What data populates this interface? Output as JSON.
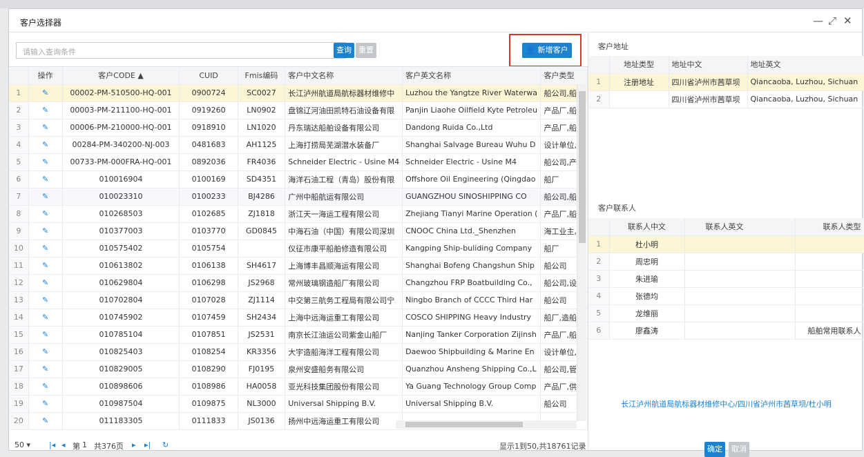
{
  "window": {
    "title": "客户选择器",
    "minimize": "—",
    "maximize": "⤢",
    "close": "✕"
  },
  "search": {
    "placeholder": "请输入查询条件",
    "query_label": "查询",
    "reset_label": "重置",
    "add_label": "新增客户"
  },
  "grid": {
    "headers": {
      "op": "操作",
      "code": "客户CODE ▲",
      "cuid": "CUID",
      "fmis": "Fmis编码",
      "cn": "客户中文名称",
      "en": "客户英文名称",
      "type": "客户类型"
    },
    "rows": [
      {
        "n": "1",
        "code": "00002-PM-510500-HQ-001",
        "cuid": "0900724",
        "fmis": "SC0027",
        "cn": "长江泸州航道局航标器材维修中",
        "en": "Luzhou the Yangtze River Waterwa",
        "type": "船公司,船厂"
      },
      {
        "n": "2",
        "code": "00003-PM-211100-HQ-001",
        "cuid": "0919260",
        "fmis": "LN0902",
        "cn": "盘锦辽河油田凯特石油设备有限",
        "en": "Panjin Liaohe Oilfield Kyte Petroleu",
        "type": "产品厂,船公"
      },
      {
        "n": "3",
        "code": "00006-PM-210000-HQ-001",
        "cuid": "0918910",
        "fmis": "LN1020",
        "cn": "丹东瑞达船舶设备有限公司",
        "en": "Dandong Ruida Co.,Ltd",
        "type": "产品厂,船厂"
      },
      {
        "n": "4",
        "code": "00284-PM-340200-NJ-003",
        "cuid": "0481683",
        "fmis": "AH1125",
        "cn": "上海打捞局芜湖潜水装备厂",
        "en": "Shanghai Salvage Bureau Wuhu D",
        "type": "设计单位,产"
      },
      {
        "n": "5",
        "code": "00733-PM-000FRA-HQ-001",
        "cuid": "0892036",
        "fmis": "FR4036",
        "cn": "Schneider Electric - Usine M4",
        "en": "Schneider Electric - Usine M4",
        "type": "船公司,产品"
      },
      {
        "n": "6",
        "code": "010016904",
        "cuid": "0100169",
        "fmis": "SD4351",
        "cn": "海洋石油工程（青岛）股份有限",
        "en": "Offshore Oil Engineering (Qingdao",
        "type": "船厂"
      },
      {
        "n": "7",
        "code": "010023310",
        "cuid": "0100233",
        "fmis": "BJ4286",
        "cn": "广州中船航运有限公司",
        "en": "GUANGZHOU SINOSHIPPING CO",
        "type": "船公司,船厂"
      },
      {
        "n": "8",
        "code": "010268503",
        "cuid": "0102685",
        "fmis": "ZJ1818",
        "cn": "浙江天一海运工程有限公司",
        "en": "Zhejiang Tianyi Marine Operation (",
        "type": "产品厂,船公"
      },
      {
        "n": "9",
        "code": "010377003",
        "cuid": "0103770",
        "fmis": "GD0845",
        "cn": "中海石油（中国）有限公司深圳",
        "en": "CNOOC China Ltd._Shenzhen",
        "type": "海工业主,油"
      },
      {
        "n": "10",
        "code": "010575402",
        "cuid": "0105754",
        "fmis": "",
        "cn": "仪征市康平船舶修造有限公司",
        "en": "Kangping Ship-buliding Company",
        "type": "船厂"
      },
      {
        "n": "11",
        "code": "010613802",
        "cuid": "0106138",
        "fmis": "SH4617",
        "cn": "上海博丰昌顺海运有限公司",
        "en": "Shanghai Bofeng Changshun Ship",
        "type": "船公司"
      },
      {
        "n": "12",
        "code": "010629804",
        "cuid": "0106298",
        "fmis": "JS2968",
        "cn": "常州玻璃钢造船厂有限公司",
        "en": "Changzhou FRP Boatbuilding Co.,",
        "type": "船公司,设计"
      },
      {
        "n": "13",
        "code": "010702804",
        "cuid": "0107028",
        "fmis": "ZJ1114",
        "cn": "中交第三航务工程局有限公司宁",
        "en": "Ningbo Branch of CCCC Third Har",
        "type": "船公司"
      },
      {
        "n": "14",
        "code": "010745902",
        "cuid": "0107459",
        "fmis": "SH2434",
        "cn": "上海中远海运重工有限公司",
        "en": "COSCO SHIPPING Heavy Industry",
        "type": "船厂,造船厂"
      },
      {
        "n": "15",
        "code": "010785104",
        "cuid": "0107851",
        "fmis": "JS2531",
        "cn": "南京长江油运公司紫金山船厂",
        "en": "Nanjing Tanker Corporation Zijinsh",
        "type": "产品厂,船厂"
      },
      {
        "n": "16",
        "code": "010825403",
        "cuid": "0108254",
        "fmis": "KR3356",
        "cn": "大宇造船海洋工程有限公司",
        "en": "Daewoo Shipbuilding & Marine En",
        "type": "设计单位,船"
      },
      {
        "n": "17",
        "code": "010829005",
        "cuid": "0108290",
        "fmis": "FJ0195",
        "cn": "泉州安盛船务有限公司",
        "en": "Quanzhou Ansheng Shipping Co.,L",
        "type": "船公司,管理"
      },
      {
        "n": "18",
        "code": "010898606",
        "cuid": "0108986",
        "fmis": "HA0058",
        "cn": "亚光科技集团股份有限公司",
        "en": "Ya Guang Technology Group Comp",
        "type": "产品厂,供方"
      },
      {
        "n": "19",
        "code": "010987504",
        "cuid": "0109875",
        "fmis": "NL3000",
        "cn": "Universal Shipping B.V.",
        "en": "Universal Shipping B.V.",
        "type": "船公司"
      },
      {
        "n": "20",
        "code": "011183305",
        "cuid": "0111833",
        "fmis": "JS0136",
        "cn": "扬州中远海运重工有限公司",
        "en": "",
        "type": ""
      }
    ]
  },
  "pager": {
    "page_size": "50 ▾",
    "first": "|◂",
    "prev": "◂",
    "page_label": "第",
    "page": "1",
    "total_pages": "共376页",
    "next": "▸",
    "last": "▸|",
    "refresh": "↻",
    "status": "显示1到50,共18761记录"
  },
  "address": {
    "title": "客户地址",
    "headers": {
      "type": "地址类型",
      "cn": "地址中文",
      "en": "地址英文"
    },
    "rows": [
      {
        "n": "1",
        "type": "注册地址",
        "cn": "四川省泸州市茜草坝",
        "en": "Qiancaoba, Luzhou, Sichuan"
      },
      {
        "n": "2",
        "type": "",
        "cn": "四川省泸州市茜草坝",
        "en": "Qiancaoba, Luzhou, Sichuan"
      }
    ]
  },
  "contacts": {
    "title": "客户联系人",
    "headers": {
      "cn": "联系人中文",
      "en": "联系人英文",
      "type": "联系人类型"
    },
    "rows": [
      {
        "n": "1",
        "cn": "杜小明",
        "en": "",
        "type": ""
      },
      {
        "n": "2",
        "cn": "周忠明",
        "en": "",
        "type": ""
      },
      {
        "n": "3",
        "cn": "朱进瑜",
        "en": "",
        "type": ""
      },
      {
        "n": "4",
        "cn": "张德均",
        "en": "",
        "type": ""
      },
      {
        "n": "5",
        "cn": "龙维丽",
        "en": "",
        "type": ""
      },
      {
        "n": "6",
        "cn": "廖鑫涛",
        "en": "",
        "type": "船舶常用联系人"
      }
    ]
  },
  "summary": "长江泸州航道局航标器材维修中心/四川省泸州市茜草坝/杜小明",
  "footer": {
    "ok_label": "确定",
    "cancel_label": "取消"
  },
  "colors": {
    "accent": "#1b82d1",
    "selected_row": "#fdf6d6",
    "highlight_box": "#e03131"
  }
}
